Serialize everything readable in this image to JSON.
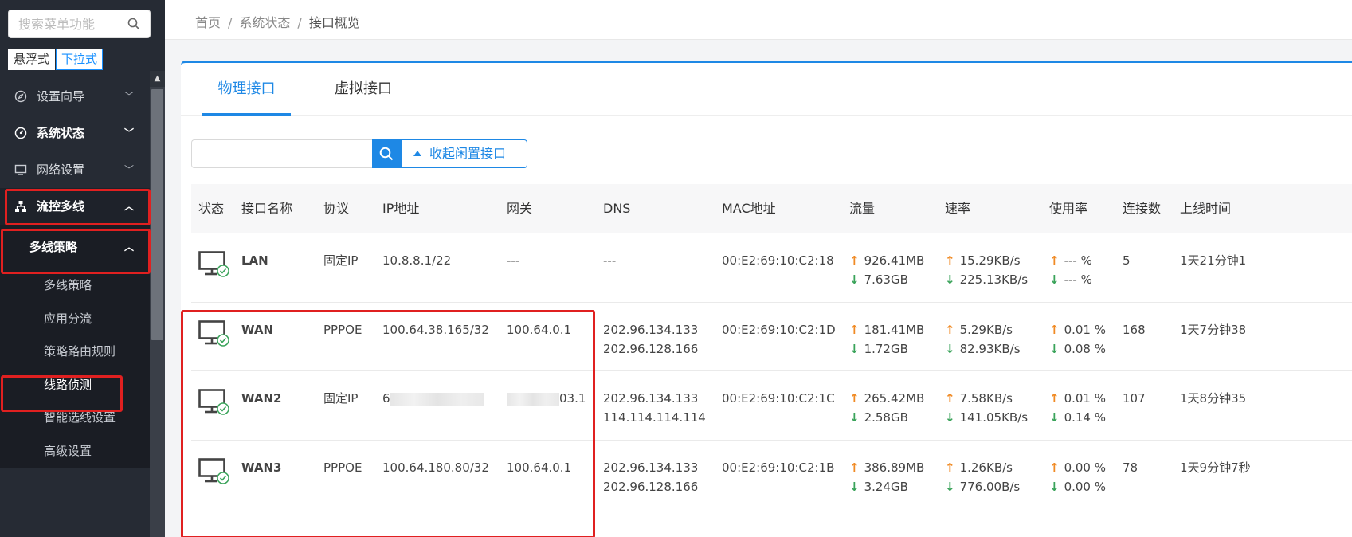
{
  "sidebar": {
    "search_placeholder": "搜索菜单功能",
    "mode_float": "悬浮式",
    "mode_dropdown": "下拉式",
    "menu": [
      {
        "label": "设置向导",
        "icon": "compass-icon"
      },
      {
        "label": "系统状态",
        "icon": "dashboard-icon"
      },
      {
        "label": "网络设置",
        "icon": "monitor-icon"
      },
      {
        "label": "流控多线",
        "icon": "network-tree-icon"
      }
    ],
    "sub_parent": "多线策略",
    "sub_items": [
      "多线策略",
      "应用分流",
      "策略路由规则",
      "线路侦测",
      "智能选线设置",
      "高级设置"
    ]
  },
  "breadcrumb": {
    "home": "首页",
    "level2": "系统状态",
    "current": "接口概览",
    "sep": "/"
  },
  "tabs": {
    "physical": "物理接口",
    "virtual": "虚拟接口"
  },
  "filter": {
    "search_value": "",
    "collapse_label": "收起闲置接口"
  },
  "table": {
    "headers": [
      "状态",
      "接口名称",
      "协议",
      "IP地址",
      "网关",
      "DNS",
      "MAC地址",
      "流量",
      "速率",
      "使用率",
      "连接数",
      "上线时间"
    ],
    "rows": [
      {
        "name": "LAN",
        "protocol": "固定IP",
        "ip": "10.8.8.1/22",
        "gateway": "---",
        "dns1": "---",
        "dns2": "",
        "mac": "00:E2:69:10:C2:18",
        "traffic_up": "926.41MB",
        "traffic_down": "7.63GB",
        "rate_up": "15.29KB/s",
        "rate_down": "225.13KB/s",
        "usage_up": "--- %",
        "usage_down": "--- %",
        "connections": "5",
        "uptime": "1天21分钟1"
      },
      {
        "name": "WAN",
        "protocol": "PPPOE",
        "ip": "100.64.38.165/32",
        "gateway": "100.64.0.1",
        "dns1": "202.96.134.133",
        "dns2": "202.96.128.166",
        "mac": "00:E2:69:10:C2:1D",
        "traffic_up": "181.41MB",
        "traffic_down": "1.72GB",
        "rate_up": "5.29KB/s",
        "rate_down": "82.93KB/s",
        "usage_up": "0.01 %",
        "usage_down": "0.08 %",
        "connections": "168",
        "uptime": "1天7分钟38"
      },
      {
        "name": "WAN2",
        "protocol": "固定IP",
        "ip": "6",
        "gateway": "03.1",
        "dns1": "202.96.134.133",
        "dns2": "114.114.114.114",
        "mac": "00:E2:69:10:C2:1C",
        "traffic_up": "265.42MB",
        "traffic_down": "2.58GB",
        "rate_up": "7.58KB/s",
        "rate_down": "141.05KB/s",
        "usage_up": "0.01 %",
        "usage_down": "0.14 %",
        "connections": "107",
        "uptime": "1天8分钟35"
      },
      {
        "name": "WAN3",
        "protocol": "PPPOE",
        "ip": "100.64.180.80/32",
        "gateway": "100.64.0.1",
        "dns1": "202.96.134.133",
        "dns2": "202.96.128.166",
        "mac": "00:E2:69:10:C2:1B",
        "traffic_up": "386.89MB",
        "traffic_down": "3.24GB",
        "rate_up": "1.26KB/s",
        "rate_down": "776.00B/s",
        "usage_up": "0.00 %",
        "usage_down": "0.00 %",
        "connections": "78",
        "uptime": "1天9分钟7秒"
      }
    ]
  },
  "arrows": {
    "up": "↑",
    "down": "↓"
  },
  "colors": {
    "accent": "#1e88e5",
    "up": "#f08a24",
    "down": "#3aa35a",
    "highlight": "#e02020",
    "sidebar": "#262b34"
  }
}
